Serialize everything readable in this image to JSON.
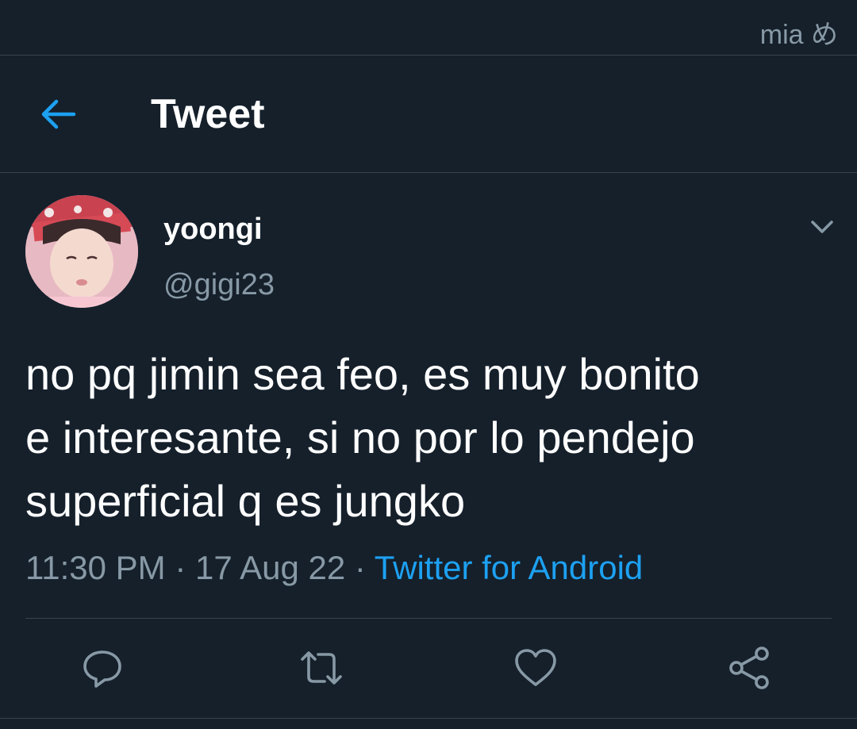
{
  "status": {
    "watermark": "mia め"
  },
  "header": {
    "title": "Tweet",
    "back_icon": "arrow-left-icon"
  },
  "tweet": {
    "author": {
      "display_name": "yoongi",
      "handle": "@gigi23",
      "avatar": "profile-photo"
    },
    "text_lines": [
      "no pq jimin sea feo, es muy bonito",
      "e interesante, si no por lo pendejo",
      "superficial q es jungko"
    ],
    "time": "11:30 PM",
    "date": "17 Aug 22",
    "source": "Twitter for Android",
    "separator": "·"
  },
  "actions": [
    {
      "name": "reply",
      "icon": "reply-icon"
    },
    {
      "name": "retweet",
      "icon": "retweet-icon"
    },
    {
      "name": "like",
      "icon": "heart-icon"
    },
    {
      "name": "share",
      "icon": "share-icon"
    }
  ],
  "colors": {
    "background": "#15202b",
    "text": "#ffffff",
    "secondary": "#8899a6",
    "accent": "#1da1f2",
    "border": "#38444d"
  }
}
